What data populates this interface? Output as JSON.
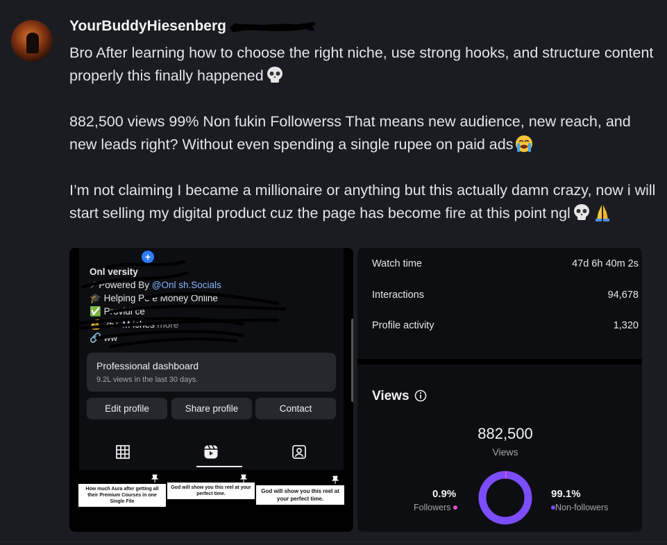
{
  "message": {
    "author": "YourBuddyHiesenberg",
    "paragraphs": [
      "Bro After learning how to choose the right niche, use strong hooks, and structure content properly this finally happened",
      "882,500 views 99% Non fukin Followerss That means new audience, new reach, and new leads right? Without even spending a single rupee on paid ads",
      "I’m not claiming I became a millionaire or anything but this actually damn crazy, now i will start selling my digital product cuz the page has become fire at this point ngl"
    ],
    "emojis": [
      "skull-emoji",
      "crying-emoji",
      "skull-emoji",
      "folded-hands-emoji"
    ]
  },
  "profile_screenshot": {
    "bio_lines": [
      {
        "icon": "",
        "text": "Onl  versity"
      },
      {
        "icon": "⚡",
        "text": "Powered By ",
        "mention": "@Onl   sh.Socials"
      },
      {
        "icon": "🎓",
        "text": "Helping Pe       e Money Online"
      },
      {
        "icon": "✅",
        "text": "Providi              ce"
      },
      {
        "icon": "💰",
        "text": "25+ M            iches",
        "more": "more"
      },
      {
        "icon": "🔗",
        "text": "ww                         "
      }
    ],
    "dashboard_title": "Professional dashboard",
    "dashboard_sub": "9.2L views in the last 30 days.",
    "buttons": [
      "Edit profile",
      "Share profile",
      "Contact"
    ],
    "tab_icons": [
      "grid-icon",
      "reels-icon",
      "tagged-icon"
    ],
    "thumbnails": [
      "How much Aura after getting all their Premium Courses in one Single File",
      "God will show you this reel at your perfect time.",
      "God will show you this reel at your perfect time."
    ]
  },
  "insights_screenshot": {
    "metrics": [
      {
        "label": "Watch time",
        "value": "47d 6h 40m 2s"
      },
      {
        "label": "Interactions",
        "value": "94,678"
      },
      {
        "label": "Profile activity",
        "value": "1,320"
      }
    ],
    "views_title": "Views",
    "views_total": "882,500",
    "views_label": "Views",
    "followers_pct": "0.9%",
    "followers_label": "Followers",
    "nonfollowers_pct": "99.1%",
    "nonfollowers_label": "Non-followers",
    "donut": {
      "followers_fraction": 0.009,
      "nonfollowers_fraction": 0.991
    },
    "colors": {
      "donut": "#7c4dff",
      "followers_dot": "#e64fd1",
      "nonfollowers_dot": "#7c4dff"
    }
  }
}
